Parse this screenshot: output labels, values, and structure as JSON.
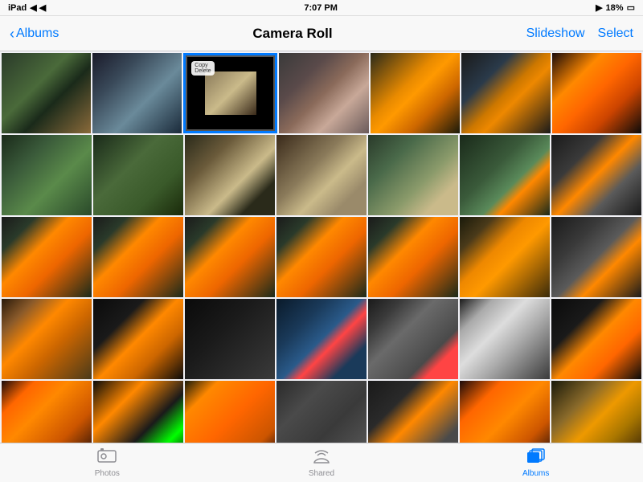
{
  "status_bar": {
    "left": "iPad",
    "center": "7:07 PM",
    "right_battery": "18%"
  },
  "nav": {
    "back_label": "Albums",
    "title": "Camera Roll",
    "slideshow_label": "Slideshow",
    "select_label": "Select"
  },
  "tabs": [
    {
      "id": "photos",
      "label": "Photos",
      "icon": "⬜",
      "active": false
    },
    {
      "id": "shared",
      "label": "Shared",
      "icon": "☁",
      "active": false
    },
    {
      "id": "albums",
      "label": "Albums",
      "icon": "⬛",
      "active": true
    }
  ],
  "photos": {
    "rows": [
      [
        "p1",
        "p2",
        "p3",
        "p4",
        "p5",
        "p6",
        "p7"
      ],
      [
        "p8",
        "p9",
        "p10",
        "p11",
        "p12",
        "p13",
        "p14"
      ],
      [
        "p15",
        "p16",
        "p17",
        "p18",
        "p19",
        "p20",
        "p21"
      ],
      [
        "p22",
        "p23",
        "p24",
        "p25",
        "p26",
        "p27",
        "p28"
      ],
      [
        "p29",
        "p30",
        "p31",
        "p32",
        "p33",
        "p34",
        "p35"
      ]
    ]
  }
}
